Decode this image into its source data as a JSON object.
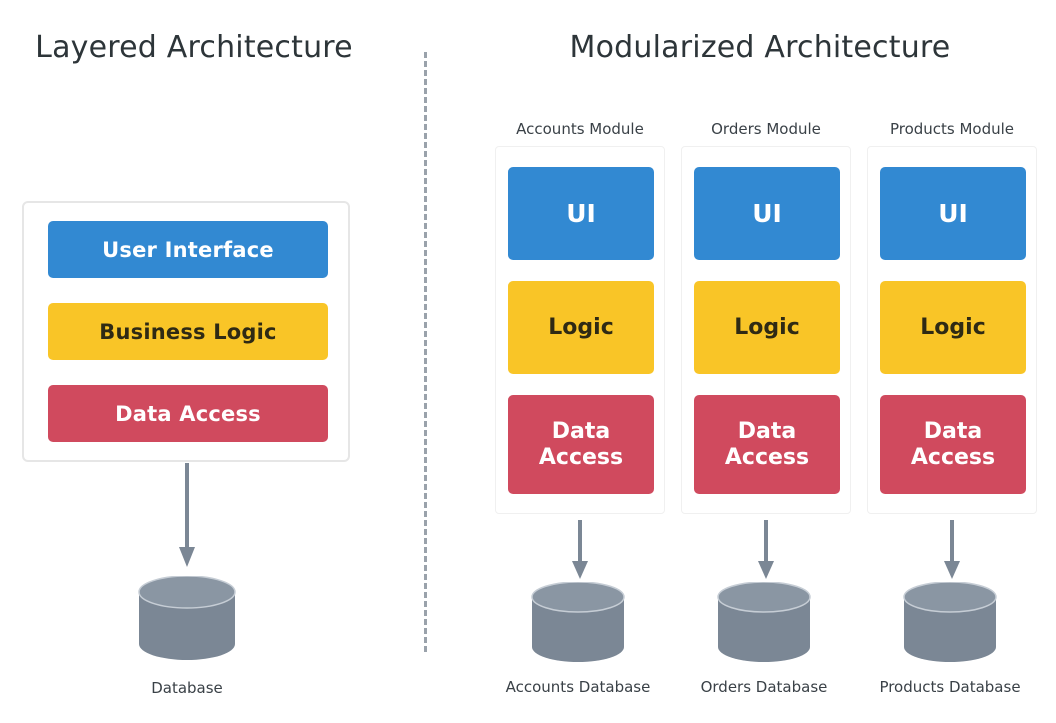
{
  "left_panel": {
    "title": "Layered Architecture",
    "layers": [
      {
        "label": "User Interface",
        "color": "#3289D2",
        "text_color": "#FFFFFF"
      },
      {
        "label": "Business Logic",
        "color": "#F9C527",
        "text_color": "#2F2A14"
      },
      {
        "label": "Data Access",
        "color": "#D04A5E",
        "text_color": "#FFFFFF"
      }
    ],
    "database": {
      "caption": "Database",
      "color": "#7B8795"
    },
    "arrow": {
      "icon": "down-arrow-icon",
      "color": "#7B8795"
    }
  },
  "right_panel": {
    "title": "Modularized Architecture",
    "modules": [
      {
        "header": "Accounts Module",
        "layers": [
          {
            "label": "UI",
            "color": "#3289D2",
            "text_color": "#FFFFFF"
          },
          {
            "label": "Logic",
            "color": "#F9C527",
            "text_color": "#2F2A14"
          },
          {
            "label": "Data Access",
            "color": "#D04A5E",
            "text_color": "#FFFFFF"
          }
        ],
        "database": {
          "caption": "Accounts Database",
          "color": "#7B8795"
        }
      },
      {
        "header": "Orders Module",
        "layers": [
          {
            "label": "UI",
            "color": "#3289D2",
            "text_color": "#FFFFFF"
          },
          {
            "label": "Logic",
            "color": "#F9C527",
            "text_color": "#2F2A14"
          },
          {
            "label": "Data Access",
            "color": "#D04A5E",
            "text_color": "#FFFFFF"
          }
        ],
        "database": {
          "caption": "Orders Database",
          "color": "#7B8795"
        }
      },
      {
        "header": "Products Module",
        "layers": [
          {
            "label": "UI",
            "color": "#3289D2",
            "text_color": "#FFFFFF"
          },
          {
            "label": "Logic",
            "color": "#F9C527",
            "text_color": "#2F2A14"
          },
          {
            "label": "Data Access",
            "color": "#D04A5E",
            "text_color": "#FFFFFF"
          }
        ],
        "database": {
          "caption": "Products Database",
          "color": "#7B8795"
        }
      }
    ]
  },
  "divider": {
    "style": "dashed-vertical",
    "color": "#9AA2AB"
  },
  "palette": {
    "ui_blue": "#3289D2",
    "logic_yellow": "#F9C527",
    "data_red": "#D04A5E",
    "database_gray": "#7B8795",
    "title_text": "#2D3539",
    "panel_border": "#E6E6E6",
    "background": "#FFFFFF"
  }
}
